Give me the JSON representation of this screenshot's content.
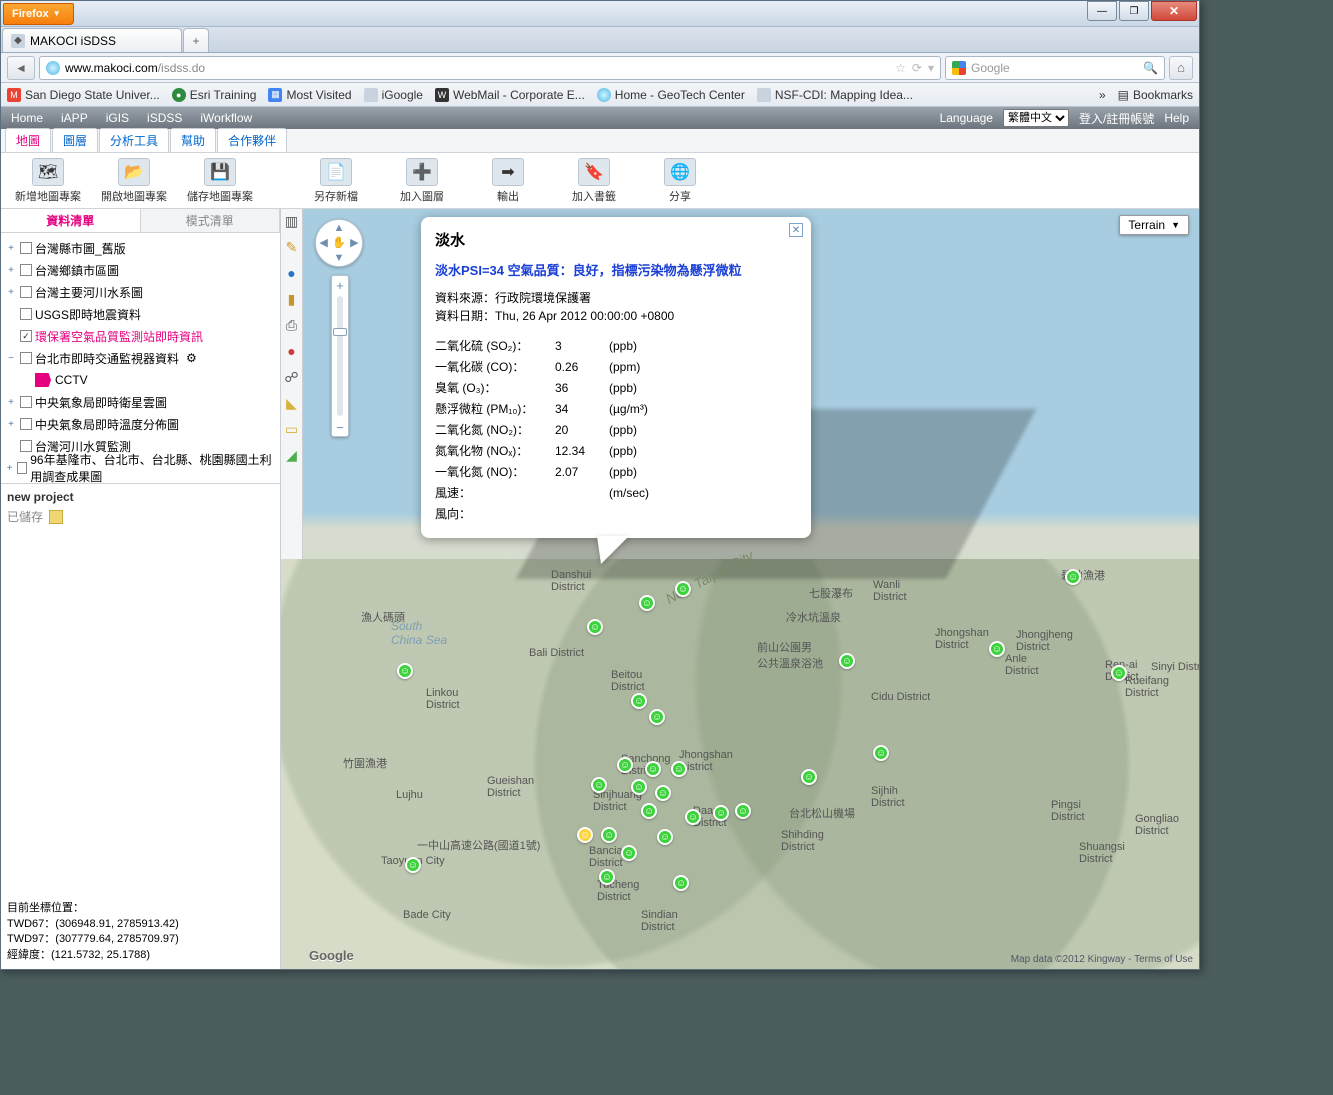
{
  "browser": {
    "name": "Firefox",
    "tab_title": "MAKOCI iSDSS",
    "url_host": "www.makoci.com",
    "url_path": "/isdss.do",
    "search_placeholder": "Google",
    "min_icon": "—",
    "max_icon": "❐",
    "close_icon": "✕",
    "add_tab": "+"
  },
  "bookmarks": [
    {
      "label": "San Diego State Univer...",
      "icon": "M",
      "cls": "red"
    },
    {
      "label": "Esri Training",
      "icon": "●",
      "cls": "gr"
    },
    {
      "label": "Most Visited",
      "icon": "▦",
      "cls": "bl"
    },
    {
      "label": "iGoogle",
      "icon": "",
      "cls": ""
    },
    {
      "label": "WebMail - Corporate E...",
      "icon": "W",
      "cls": "dk"
    },
    {
      "label": "Home - GeoTech Center",
      "icon": "",
      "cls": "gl"
    },
    {
      "label": "NSF-CDI: Mapping Idea...",
      "icon": "",
      "cls": ""
    }
  ],
  "bookmarks_more": "»",
  "bookmarks_btn": "Bookmarks",
  "appnav": {
    "items": [
      "Home",
      "iAPP",
      "iGIS",
      "iSDSS",
      "iWorkflow"
    ],
    "language_label": "Language",
    "language_value": "繁體中文",
    "login": "登入/註冊帳號",
    "help": "Help"
  },
  "subtabs": [
    "地圖",
    "圖層",
    "分析工具",
    "幫助",
    "合作夥伴"
  ],
  "bigtools": [
    "新增地圖專案",
    "開啟地圖專案",
    "儲存地圖專案",
    "另存新檔",
    "加入圖層",
    "輸出",
    "加入書籤",
    "分享"
  ],
  "lp_tabs": [
    "資料清單",
    "模式清單"
  ],
  "tree": [
    {
      "exp": "+",
      "checked": false,
      "label": "台灣縣市圖_舊版"
    },
    {
      "exp": "+",
      "checked": false,
      "label": "台灣鄉鎮市區圖"
    },
    {
      "exp": "+",
      "checked": false,
      "label": "台灣主要河川水系圖"
    },
    {
      "exp": "",
      "checked": false,
      "label": "USGS即時地震資料"
    },
    {
      "exp": "",
      "checked": true,
      "label": "環保署空氣品質監測站即時資訊",
      "active": true
    },
    {
      "exp": "−",
      "checked": false,
      "label": "台北市即時交通監視器資料",
      "child": "CCTV",
      "gear": true
    },
    {
      "exp": "+",
      "checked": false,
      "label": "中央氣象局即時衛星雲圖"
    },
    {
      "exp": "+",
      "checked": false,
      "label": "中央氣象局即時溫度分佈圖"
    },
    {
      "exp": "",
      "checked": false,
      "label": "台灣河川水質監測"
    },
    {
      "exp": "+",
      "checked": false,
      "label": "96年基隆市、台北市、台北縣、桃園縣國土利用調查成果圖"
    }
  ],
  "project": {
    "title": "new project",
    "saved": "已儲存"
  },
  "coords": {
    "label": "目前坐標位置：",
    "twd67": "TWD67：(306948.91, 2785913.42)",
    "twd97": "TWD97：(307779.64, 2785709.97)",
    "lonlat": "經緯度：(121.5732, 25.1788)"
  },
  "map": {
    "terrain": "Terrain",
    "sea": "South\nChina Sea",
    "attrib": "Map data ©2012 Kingway - Terms of Use",
    "glogo": "Google",
    "districts": [
      {
        "t": 360,
        "l": 270,
        "txt": "Danshui\nDistrict"
      },
      {
        "t": 400,
        "l": 80,
        "txt": "漁人碼頭"
      },
      {
        "t": 438,
        "l": 248,
        "txt": "Bali District"
      },
      {
        "t": 478,
        "l": 145,
        "txt": "Linkou\nDistrict"
      },
      {
        "t": 460,
        "l": 330,
        "txt": "Beitou\nDistrict"
      },
      {
        "t": 376,
        "l": 528,
        "txt": "七股瀑布"
      },
      {
        "t": 400,
        "l": 505,
        "txt": "冷水坑溫泉"
      },
      {
        "t": 430,
        "l": 476,
        "txt": "前山公園男\n公共溫泉浴池"
      },
      {
        "t": 370,
        "l": 592,
        "txt": "Wanli\nDistrict"
      },
      {
        "t": 418,
        "l": 654,
        "txt": "Jhongshan\nDistrict"
      },
      {
        "t": 420,
        "l": 735,
        "txt": "Jhongjheng\nDistrict"
      },
      {
        "t": 450,
        "l": 824,
        "txt": "Ren-ai\nDistrict"
      },
      {
        "t": 444,
        "l": 724,
        "txt": "Anle\nDistrict"
      },
      {
        "t": 452,
        "l": 870,
        "txt": "Sinyi District"
      },
      {
        "t": 482,
        "l": 590,
        "txt": "Cidu District"
      },
      {
        "t": 466,
        "l": 844,
        "txt": "Rueifang\nDistrict"
      },
      {
        "t": 358,
        "l": 780,
        "txt": "碧砂漁港"
      },
      {
        "t": 544,
        "l": 340,
        "txt": "Sanchong\nDistrict"
      },
      {
        "t": 540,
        "l": 398,
        "txt": "Jhongshan\nDistrict"
      },
      {
        "t": 580,
        "l": 115,
        "txt": "Lujhu"
      },
      {
        "t": 546,
        "l": 62,
        "txt": "竹圍漁港"
      },
      {
        "t": 566,
        "l": 206,
        "txt": "Gueishan\nDistrict"
      },
      {
        "t": 580,
        "l": 312,
        "txt": "Sinjhuang\nDistrict"
      },
      {
        "t": 596,
        "l": 412,
        "txt": "Daan\nDistrict"
      },
      {
        "t": 596,
        "l": 508,
        "txt": "台北松山機場"
      },
      {
        "t": 636,
        "l": 308,
        "txt": "Banciao\nDistrict"
      },
      {
        "t": 670,
        "l": 316,
        "txt": "Tucheng\nDistrict"
      },
      {
        "t": 620,
        "l": 500,
        "txt": "Shihding\nDistrict"
      },
      {
        "t": 576,
        "l": 590,
        "txt": "Sijhih\nDistrict"
      },
      {
        "t": 590,
        "l": 770,
        "txt": "Pingsi\nDistrict"
      },
      {
        "t": 632,
        "l": 798,
        "txt": "Shuangsi\nDistrict"
      },
      {
        "t": 604,
        "l": 854,
        "txt": "Gongliao\nDistrict"
      },
      {
        "t": 646,
        "l": 100,
        "txt": "Taoyuan City"
      },
      {
        "t": 700,
        "l": 122,
        "txt": "Bade City"
      },
      {
        "t": 628,
        "l": 136,
        "txt": "一中山高速公路(國道1號)"
      },
      {
        "t": 700,
        "l": 360,
        "txt": "Sindian\nDistrict"
      }
    ],
    "dots": [
      {
        "t": 372,
        "l": 394,
        "c": "g"
      },
      {
        "t": 386,
        "l": 358,
        "c": "g"
      },
      {
        "t": 410,
        "l": 306,
        "c": "g"
      },
      {
        "t": 454,
        "l": 116,
        "c": "g"
      },
      {
        "t": 444,
        "l": 558,
        "c": "g"
      },
      {
        "t": 432,
        "l": 708,
        "c": "g"
      },
      {
        "t": 360,
        "l": 784,
        "c": "g"
      },
      {
        "t": 456,
        "l": 830,
        "c": "g"
      },
      {
        "t": 484,
        "l": 350,
        "c": "g"
      },
      {
        "t": 500,
        "l": 368,
        "c": "g"
      },
      {
        "t": 548,
        "l": 336,
        "c": "g"
      },
      {
        "t": 552,
        "l": 364,
        "c": "g"
      },
      {
        "t": 552,
        "l": 390,
        "c": "g"
      },
      {
        "t": 568,
        "l": 310,
        "c": "g"
      },
      {
        "t": 570,
        "l": 350,
        "c": "g"
      },
      {
        "t": 576,
        "l": 374,
        "c": "g"
      },
      {
        "t": 560,
        "l": 520,
        "c": "g"
      },
      {
        "t": 536,
        "l": 592,
        "c": "g"
      },
      {
        "t": 594,
        "l": 360,
        "c": "g"
      },
      {
        "t": 600,
        "l": 404,
        "c": "g"
      },
      {
        "t": 596,
        "l": 432,
        "c": "g"
      },
      {
        "t": 594,
        "l": 454,
        "c": "g"
      },
      {
        "t": 618,
        "l": 296,
        "c": "y"
      },
      {
        "t": 618,
        "l": 320,
        "c": "g"
      },
      {
        "t": 636,
        "l": 340,
        "c": "g"
      },
      {
        "t": 648,
        "l": 124,
        "c": "g"
      },
      {
        "t": 660,
        "l": 318,
        "c": "g"
      },
      {
        "t": 666,
        "l": 392,
        "c": "g"
      },
      {
        "t": 620,
        "l": 376,
        "c": "g"
      }
    ]
  },
  "bubble": {
    "title": "淡水",
    "summary": "淡水PSI=34 空氣品質：良好，指標污染物為懸浮微粒",
    "source_label": "資料來源：",
    "source": "行政院環境保護署",
    "date_label": "資料日期：",
    "date": "Thu, 26 Apr 2012 00:00:00 +0800",
    "rows": [
      {
        "name": "二氧化硫 (SO₂)：",
        "val": "3",
        "unit": "(ppb)"
      },
      {
        "name": "一氧化碳 (CO)：",
        "val": "0.26",
        "unit": "(ppm)"
      },
      {
        "name": "臭氧 (O₃)：",
        "val": "36",
        "unit": "(ppb)"
      },
      {
        "name": "懸浮微粒 (PM₁₀)：",
        "val": "34",
        "unit": "(µg/m³)"
      },
      {
        "name": "二氧化氮 (NO₂)：",
        "val": "20",
        "unit": "(ppb)"
      },
      {
        "name": "氮氧化物 (NOₓ)：",
        "val": "12.34",
        "unit": "(ppb)"
      },
      {
        "name": "一氧化氮 (NO)：",
        "val": "2.07",
        "unit": "(ppb)"
      },
      {
        "name": "風速：",
        "val": "",
        "unit": "(m/sec)"
      },
      {
        "name": "風向：",
        "val": "",
        "unit": ""
      }
    ]
  }
}
